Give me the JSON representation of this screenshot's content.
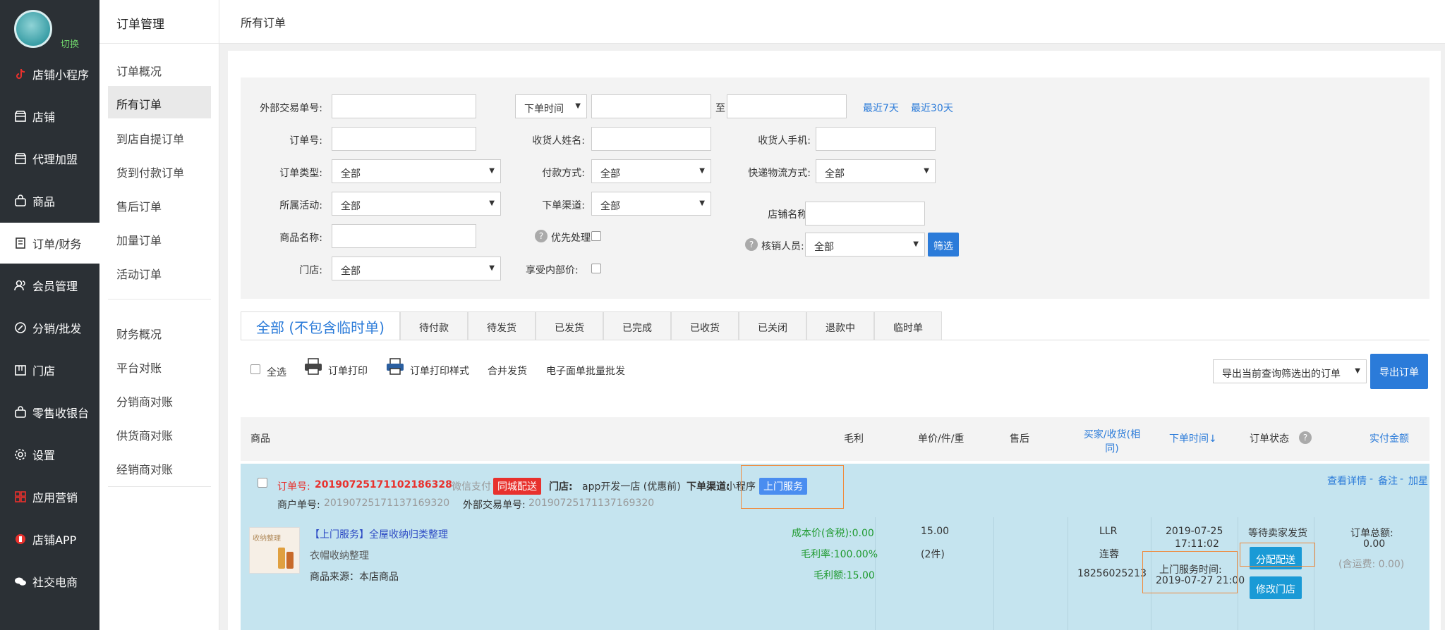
{
  "sidebar": {
    "switch_label": "切换",
    "items": [
      {
        "label": "店铺小程序",
        "icon": "tiktok-icon"
      },
      {
        "label": "店铺",
        "icon": "store-icon"
      },
      {
        "label": "代理加盟",
        "icon": "store-icon"
      },
      {
        "label": "商品",
        "icon": "bag-icon"
      },
      {
        "label": "订单/财务",
        "icon": "order-icon"
      },
      {
        "label": "会员管理",
        "icon": "members-icon"
      },
      {
        "label": "分销/批发",
        "icon": "distribution-icon"
      },
      {
        "label": "门店",
        "icon": "shop-icon"
      },
      {
        "label": "零售收银台",
        "icon": "cashier-icon"
      },
      {
        "label": "设置",
        "icon": "gear-icon"
      },
      {
        "label": "应用营销",
        "icon": "apps-icon"
      },
      {
        "label": "店铺APP",
        "icon": "app-icon"
      },
      {
        "label": "社交电商",
        "icon": "chat-icon"
      }
    ]
  },
  "subnav": {
    "title": "订单管理",
    "group1": [
      "订单概况",
      "所有订单",
      "到店自提订单",
      "货到付款订单",
      "售后订单",
      "加量订单",
      "活动订单"
    ],
    "group2": [
      "财务概况",
      "平台对账",
      "分销商对账",
      "供货商对账",
      "经销商对账"
    ]
  },
  "page_title": "所有订单",
  "filter": {
    "ext_trade_no_label": "外部交易单号:",
    "time_type": "下单时间",
    "to_label": "至",
    "last7": "最近7天",
    "last30": "最近30天",
    "order_no_label": "订单号:",
    "receiver_name_label": "收货人姓名:",
    "receiver_phone_label": "收货人手机:",
    "order_type_label": "订单类型:",
    "order_type_value": "全部",
    "pay_method_label": "付款方式:",
    "pay_method_value": "全部",
    "express_label": "快递物流方式:",
    "express_value": "全部",
    "activity_label": "所属活动:",
    "activity_value": "全部",
    "channel_label": "下单渠道:",
    "channel_value": "全部",
    "store_name_label": "店铺名称:",
    "product_name_label": "商品名称:",
    "priority_label": "优先处理:",
    "verifier_label": "核销人员:",
    "verifier_value": "全部",
    "filter_button": "筛选",
    "shop_label": "门店:",
    "shop_value": "全部",
    "internal_price_label": "享受内部价:"
  },
  "tabs": [
    "全部 (不包含临时单)",
    "待付款",
    "待发货",
    "已发货",
    "已完成",
    "已收货",
    "已关闭",
    "退款中",
    "临时单"
  ],
  "toolbar": {
    "select_all": "全选",
    "print": "订单打印",
    "print_style": "订单打印样式",
    "merge_ship": "合并发货",
    "batch_waybill": "电子面单批量批发",
    "export_select": "导出当前查询筛选出的订单",
    "export_button": "导出订单"
  },
  "table_header": {
    "product": "商品",
    "gross_profit": "毛利",
    "unit_price": "单价/件/重",
    "after_sale": "售后",
    "buyer": "买家/收货(相同)",
    "order_time": "下单时间↓",
    "status": "订单状态",
    "paid": "实付金额"
  },
  "order": {
    "order_no_label": "订单号:",
    "order_no": "20190725171102186328",
    "pay_type": "微信支付",
    "delivery_badge": "同城配送",
    "store_label": "门店:",
    "store": "app开发一店 (优惠前)",
    "channel_label": "下单渠道:",
    "channel": "小程序",
    "service_badge": "上门服务",
    "merchant_no_label": "商户单号:",
    "merchant_no": "20190725171137169320",
    "ext_no_label": "外部交易单号:",
    "ext_no": "20190725171137169320",
    "actions": {
      "detail": "查看详情",
      "sep": "-",
      "note": "备注",
      "add": "加星"
    },
    "product_title": "【上门服务】全屋收纳归类整理",
    "product_subtitle": "衣帽收纳整理",
    "product_source": "商品来源：本店商品",
    "thumb_text": "收纳整理",
    "cost": "成本价(含税):0.00",
    "margin_rate": "毛利率:100.00%",
    "margin_amount": "毛利额:15.00",
    "price": "15.00",
    "qty": "(2件)",
    "buyer_name": "LLR",
    "receiver": "连蓉",
    "phone": "18256025213",
    "order_date": "2019-07-25",
    "order_clock": "17:11:02",
    "service_time_label": "上门服务时间:",
    "service_time": "2019-07-27 21:00",
    "status": "等待卖家发货",
    "assign_button": "分配配送",
    "change_shop_button": "修改门店",
    "total_label": "订单总额:",
    "total": "0.00",
    "shipping": "(含运费: 0.00)"
  },
  "colors": {
    "sidebar_bg": "#2b3035",
    "accent": "#2b7bd9",
    "order_bg": "#c5e4ef",
    "red": "#e8312d",
    "cyan_button": "#1a9ad6",
    "green": "#1f9a2f"
  }
}
